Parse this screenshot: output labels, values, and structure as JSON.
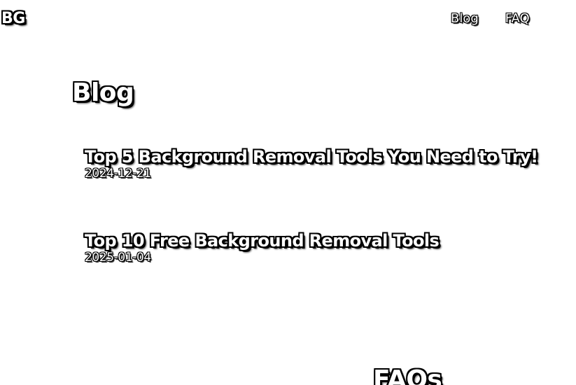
{
  "header": {
    "logo": "BG",
    "nav": [
      {
        "label": "Blog"
      },
      {
        "label": "FAQ"
      }
    ]
  },
  "blog": {
    "heading": "Blog",
    "posts": [
      {
        "title": "Top 5 Background Removal Tools You Need to Try!",
        "date": "2024-12-21"
      },
      {
        "title": "Top 10 Free Background Removal Tools",
        "date": "2025-01-04"
      }
    ]
  },
  "faq": {
    "heading": "FAQs"
  }
}
